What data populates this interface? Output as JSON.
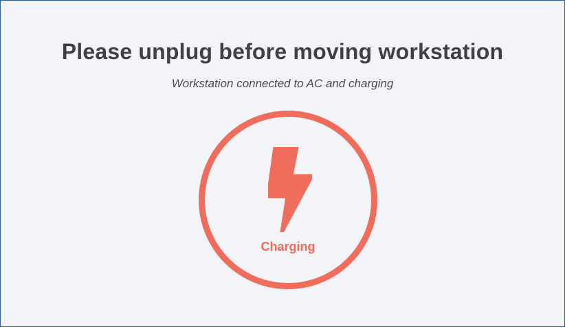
{
  "header": {
    "title": "Please unplug before moving workstation",
    "subtitle": "Workstation connected to AC and charging"
  },
  "status": {
    "label": "Charging",
    "icon": "lightning-bolt-icon",
    "color": "#f06c5c"
  }
}
